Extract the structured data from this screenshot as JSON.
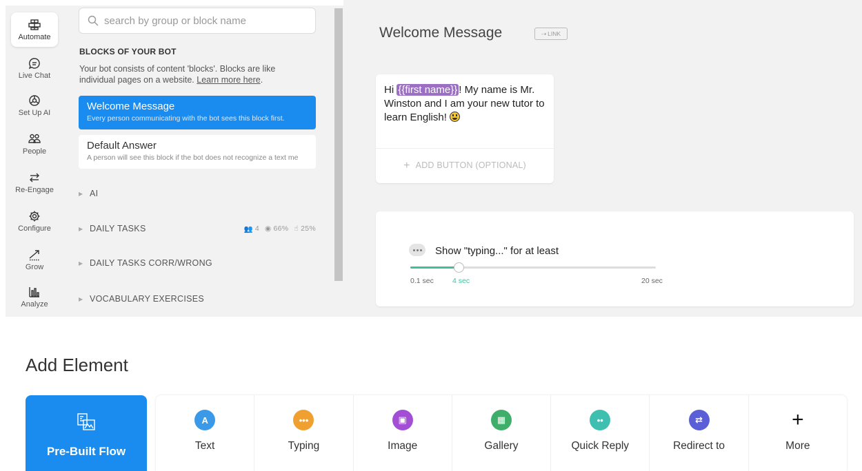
{
  "sidebar": {
    "items": [
      {
        "label": "Automate",
        "icon": "automate-icon",
        "active": true
      },
      {
        "label": "Live Chat",
        "icon": "chat-icon"
      },
      {
        "label": "Set Up AI",
        "icon": "ai-icon"
      },
      {
        "label": "People",
        "icon": "people-icon"
      },
      {
        "label": "Re-Engage",
        "icon": "re-engage-icon"
      },
      {
        "label": "Configure",
        "icon": "gear-icon"
      },
      {
        "label": "Grow",
        "icon": "grow-icon"
      },
      {
        "label": "Analyze",
        "icon": "analyze-icon"
      }
    ]
  },
  "blocks_panel": {
    "search_placeholder": "search by group or block name",
    "heading": "BLOCKS OF YOUR BOT",
    "description": "Your bot consists of content 'blocks'. Blocks are like individual pages on a website.",
    "learn_more": "Learn more here",
    "blocks": [
      {
        "name": "Welcome Message",
        "description": "Every person communicating with the bot sees this block first.",
        "selected": true
      },
      {
        "name": "Default Answer",
        "description": "A person will see this block if the bot does not recognize a text me"
      }
    ],
    "groups": [
      {
        "name": "AI"
      },
      {
        "name": "DAILY TASKS",
        "stats": {
          "users": "4",
          "seen": "66%",
          "clicked": "25%"
        }
      },
      {
        "name": "DAILY TASKS CORR/WRONG"
      },
      {
        "name": "VOCABULARY EXERCISES"
      }
    ]
  },
  "editor": {
    "title": "Welcome Message",
    "link_label": "LINK",
    "message": {
      "prefix": "Hi ",
      "attribute": "{{first name}}",
      "text": "! My name is Mr. Winston and I am your new tutor to learn English! ",
      "emoji": "grinning-face"
    },
    "add_button_label": "ADD BUTTON (OPTIONAL)",
    "typing": {
      "label": "Show \"typing...\" for at least",
      "min": "0.1 sec",
      "value": "4 sec",
      "max": "20 sec",
      "min_value": 0.1,
      "current_value": 4,
      "max_value": 20
    }
  },
  "add_element": {
    "title": "Add Element",
    "prebuilt_label": "Pre-Built Flow",
    "items": [
      {
        "label": "Text",
        "icon": "text-icon",
        "color": "#3b9ae8",
        "glyph": "A"
      },
      {
        "label": "Typing",
        "icon": "typing-icon",
        "color": "#f0a030",
        "glyph": "•••"
      },
      {
        "label": "Image",
        "icon": "image-icon",
        "color": "#a24fd6",
        "glyph": "▣"
      },
      {
        "label": "Gallery",
        "icon": "gallery-icon",
        "color": "#3fae6a",
        "glyph": "▦"
      },
      {
        "label": "Quick Reply",
        "icon": "quick-reply-icon",
        "color": "#3fbfb0",
        "glyph": "••"
      },
      {
        "label": "Redirect to",
        "icon": "redirect-icon",
        "color": "#5a5fd8",
        "glyph": "⇄"
      },
      {
        "label": "More",
        "icon": "plus-icon",
        "color": "#111111",
        "glyph": "+"
      }
    ]
  }
}
